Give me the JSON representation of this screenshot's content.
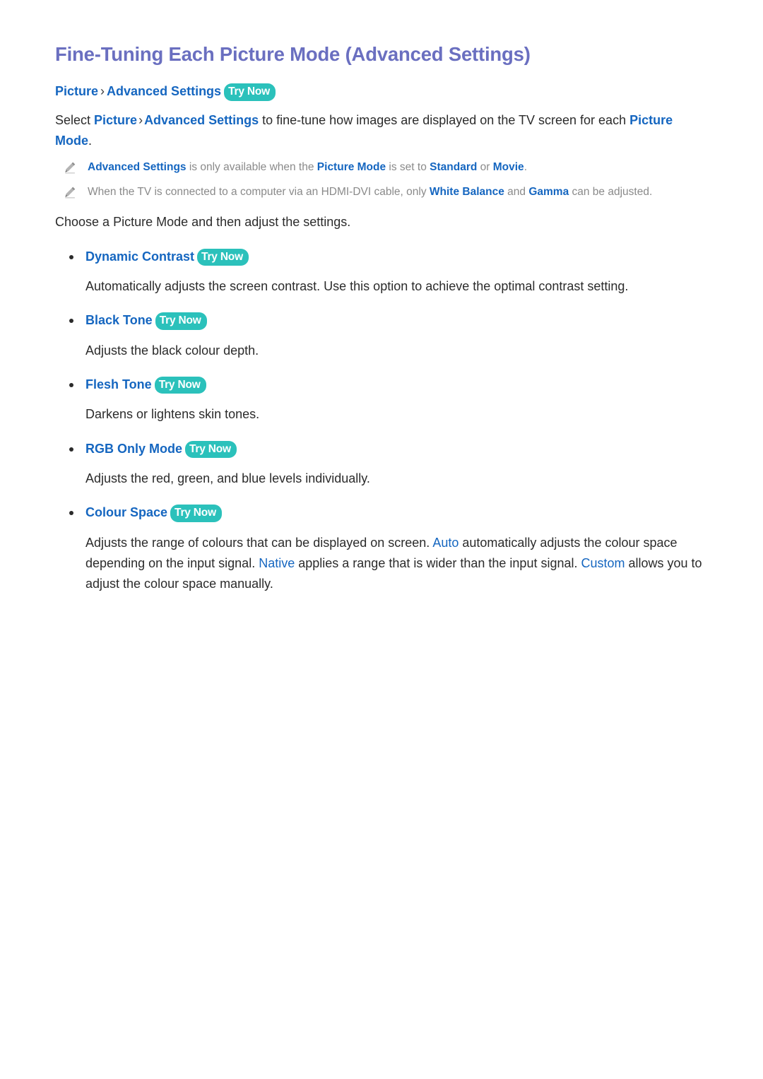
{
  "page": {
    "title": "Fine-Tuning Each Picture Mode (Advanced Settings)",
    "background_color": "#FFFFFF",
    "title_color": "#6A6FC0",
    "link_color": "#1566C0",
    "badge_color": "#2BC1BB",
    "note_text_color": "#8A8A8A",
    "body_text_color": "#2B2B2B"
  },
  "breadcrumb": {
    "item1": "Picture",
    "separator": "›",
    "item2": "Advanced Settings",
    "badge": "Try Now"
  },
  "intro": {
    "part1": "Select ",
    "link1": "Picture",
    "separator": "›",
    "link2": "Advanced Settings",
    "part2": " to fine-tune how images are displayed on the TV screen for each ",
    "link3": "Picture Mode",
    "part3": "."
  },
  "notes": [
    {
      "icon": "pencil-icon",
      "seg1": "Advanced Settings",
      "seg2": " is only available when the ",
      "seg3": "Picture Mode",
      "seg4": " is set to ",
      "seg5": "Standard",
      "seg6": " or ",
      "seg7": "Movie",
      "seg8": "."
    },
    {
      "icon": "pencil-icon",
      "seg1": "When the TV is connected to a computer via an HDMI-DVI cable, only ",
      "seg2": "White Balance",
      "seg3": " and ",
      "seg4": "Gamma",
      "seg5": " can be adjusted."
    }
  ],
  "choose_line": {
    "part1": "Choose a ",
    "link1": "Picture Mode",
    "part2": " and then adjust the settings."
  },
  "settings": [
    {
      "name": "Dynamic Contrast",
      "badge": "Try Now",
      "description": "Automatically adjusts the screen contrast. Use this option to achieve the optimal contrast setting."
    },
    {
      "name": "Black Tone",
      "badge": "Try Now",
      "description": "Adjusts the black colour depth."
    },
    {
      "name": "Flesh Tone",
      "badge": "Try Now",
      "description": "Darkens or lightens skin tones."
    },
    {
      "name": "RGB Only Mode",
      "badge": "Try Now",
      "description": "Adjusts the red, green, and blue levels individually."
    },
    {
      "name": "Colour Space",
      "badge": "Try Now",
      "description_parts": {
        "p1": "Adjusts the range of colours that can be displayed on screen. ",
        "l1": "Auto",
        "p2": " automatically adjusts the colour space depending on the input signal. ",
        "l2": "Native",
        "p3": " applies a range that is wider than the input signal. ",
        "l3": "Custom",
        "p4": " allows you to adjust the colour space manually."
      }
    }
  ]
}
